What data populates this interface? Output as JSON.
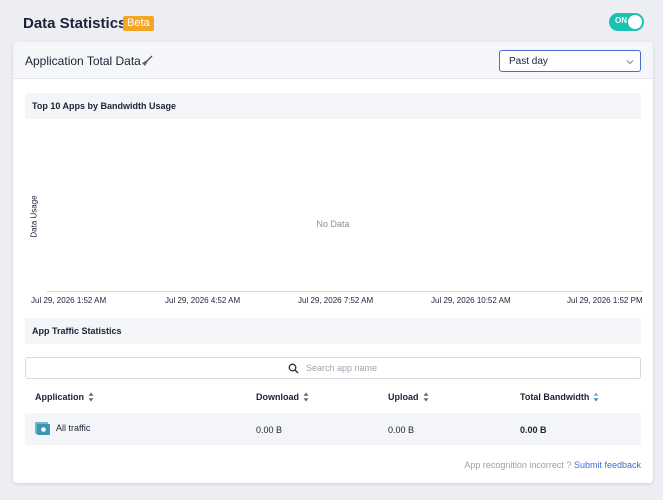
{
  "header": {
    "title": "Data Statistics",
    "badge": "Beta",
    "toggle_label": "ON"
  },
  "card": {
    "title": "Application Total Data",
    "time_range": {
      "selected": "Past day"
    }
  },
  "chart_section": {
    "title": "Top 10 Apps by Bandwidth Usage"
  },
  "chart_data": {
    "type": "line",
    "ylabel": "Data Usage",
    "x_ticks": [
      "Jul 29, 2026 1:52 AM",
      "Jul 29, 2026 4:52 AM",
      "Jul 29, 2026 7:52 AM",
      "Jul 29, 2026 10:52 AM",
      "Jul 29, 2026 1:52 PM"
    ],
    "series": [],
    "empty_message": "No Data"
  },
  "traffic_section": {
    "title": "App Traffic Statistics"
  },
  "search": {
    "placeholder": "Search app name",
    "value": ""
  },
  "table": {
    "columns": [
      "Application",
      "Download",
      "Upload",
      "Total Bandwidth"
    ],
    "rows": [
      {
        "application": "All traffic",
        "download": "0.00 B",
        "upload": "0.00 B",
        "total": "0.00 B"
      }
    ]
  },
  "footer": {
    "note": "App recognition incorrect ?",
    "link": "Submit feedback"
  },
  "colors": {
    "accent": "#3a6fd8",
    "badge": "#f5a524",
    "toggle": "#17c3b1",
    "sort_active": "#1a9fd0"
  }
}
